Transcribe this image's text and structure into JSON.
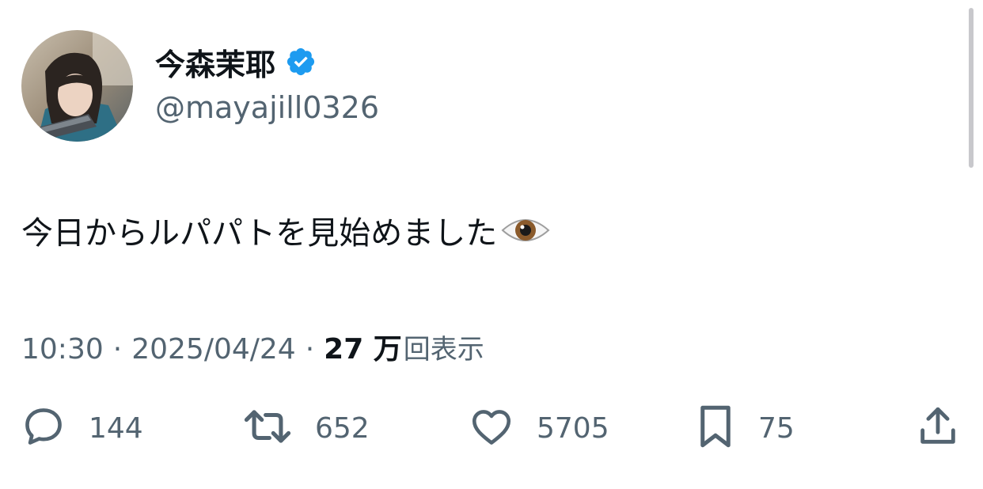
{
  "user": {
    "display_name": "今森茉耶",
    "handle": "@mayajill0326",
    "verified_icon": "verified-badge-icon",
    "avatar_icon": "profile-avatar"
  },
  "tweet": {
    "text": "今日からルパパトを見始めました",
    "emoji_icon": "eye-emoji-icon"
  },
  "meta": {
    "time": "10:30",
    "date": "2025/04/24",
    "separator": "·",
    "views_count": "27 万",
    "views_label": "回表示"
  },
  "actions": {
    "reply_count": "144",
    "retweet_count": "652",
    "like_count": "5705",
    "bookmark_count": "75",
    "share_icon": "share-icon"
  },
  "colors": {
    "primary_text": "#0f1419",
    "secondary_text": "#536471",
    "verified_blue": "#1d9bf0",
    "background": "#ffffff"
  }
}
